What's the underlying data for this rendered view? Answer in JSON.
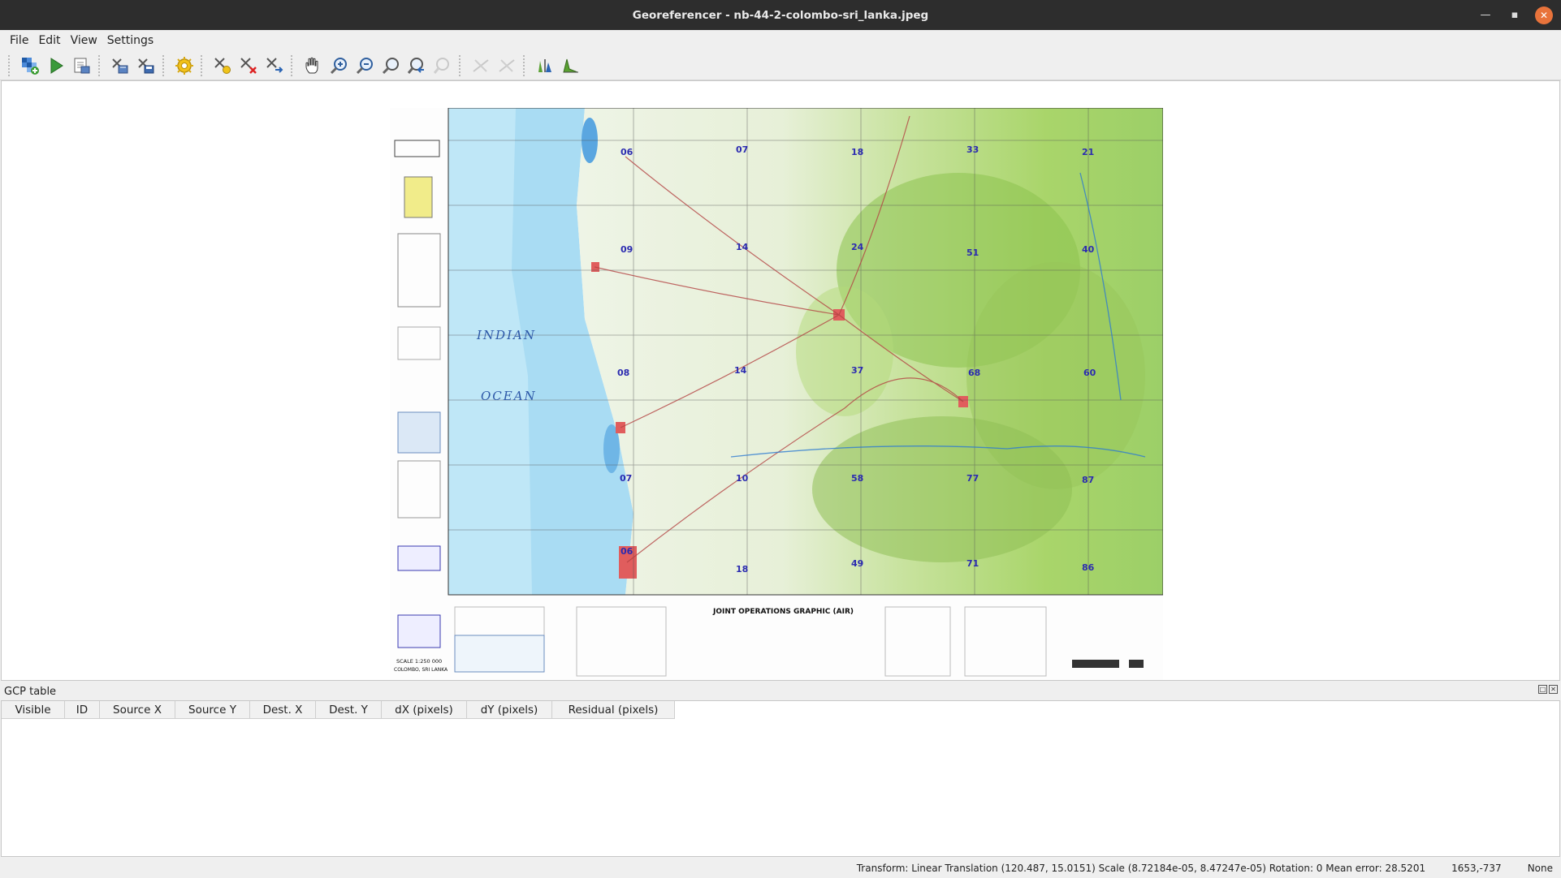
{
  "window": {
    "title": "Georeferencer - nb-44-2-colombo-sri_lanka.jpeg"
  },
  "menu": [
    "File",
    "Edit",
    "View",
    "Settings"
  ],
  "toolbar": {
    "buttons": [
      {
        "name": "open-raster-icon"
      },
      {
        "name": "start-georeferencing-icon"
      },
      {
        "name": "generate-gdal-script-icon"
      },
      {
        "name": "load-gcp-points-icon"
      },
      {
        "name": "save-gcp-points-icon"
      },
      {
        "name": "transformation-settings-icon"
      },
      {
        "name": "add-point-icon"
      },
      {
        "name": "delete-point-icon"
      },
      {
        "name": "move-gcp-point-icon"
      },
      {
        "name": "pan-icon"
      },
      {
        "name": "zoom-in-icon"
      },
      {
        "name": "zoom-out-icon"
      },
      {
        "name": "zoom-to-layer-icon"
      },
      {
        "name": "zoom-last-icon"
      },
      {
        "name": "zoom-next-icon"
      },
      {
        "name": "link-georeferencer-to-qgis-icon"
      },
      {
        "name": "link-qgis-to-georeferencer-icon"
      },
      {
        "name": "full-histogram-stretch-icon"
      },
      {
        "name": "local-histogram-stretch-icon"
      }
    ]
  },
  "map": {
    "labels": {
      "ocean1": "INDIAN",
      "ocean2": "OCEAN",
      "title": "JOINT OPERATIONS GRAPHIC (AIR)",
      "scale_left": "SCALE 1:250 000",
      "sheet_name": "COLOMBO, SRI LANKA"
    },
    "grid_numbers": [
      "06",
      "07",
      "18",
      "33",
      "21",
      "09",
      "14",
      "24",
      "51",
      "40",
      "08",
      "14",
      "37",
      "68",
      "60",
      "07",
      "10",
      "58",
      "77",
      "87",
      "06",
      "18",
      "49",
      "71",
      "86"
    ]
  },
  "gcp": {
    "dock_title": "GCP table",
    "columns": [
      "Visible",
      "ID",
      "Source X",
      "Source Y",
      "Dest. X",
      "Dest. Y",
      "dX (pixels)",
      "dY (pixels)",
      "Residual (pixels)"
    ]
  },
  "status": {
    "transform": "Transform: Linear Translation (120.487, 15.0151) Scale (8.72184e-05, 8.47247e-05) Rotation: 0 Mean error: 28.5201",
    "coords": "1653,-737",
    "crs": "None"
  }
}
